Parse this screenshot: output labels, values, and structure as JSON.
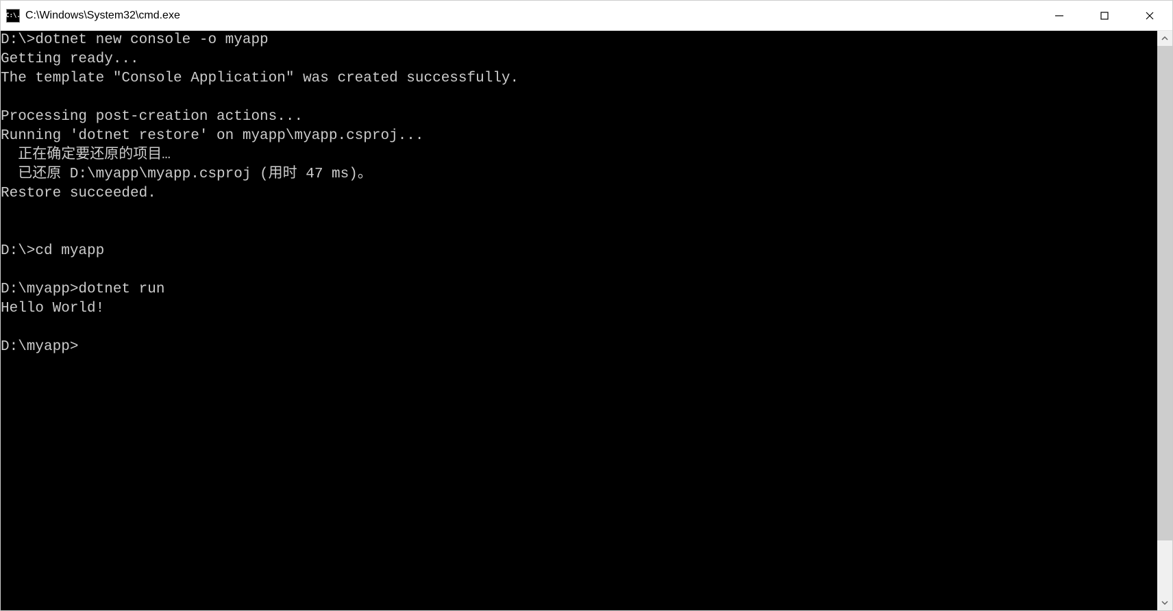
{
  "titlebar": {
    "icon_label": "C:\\.",
    "title": "C:\\Windows\\System32\\cmd.exe"
  },
  "terminal": {
    "lines": [
      "D:\\>dotnet new console -o myapp",
      "Getting ready...",
      "The template \"Console Application\" was created successfully.",
      "",
      "Processing post-creation actions...",
      "Running 'dotnet restore' on myapp\\myapp.csproj...",
      "  正在确定要还原的项目…",
      "  已还原 D:\\myapp\\myapp.csproj (用时 47 ms)。",
      "Restore succeeded.",
      "",
      "",
      "D:\\>cd myapp",
      "",
      "D:\\myapp>dotnet run",
      "Hello World!",
      "",
      "D:\\myapp>"
    ]
  }
}
